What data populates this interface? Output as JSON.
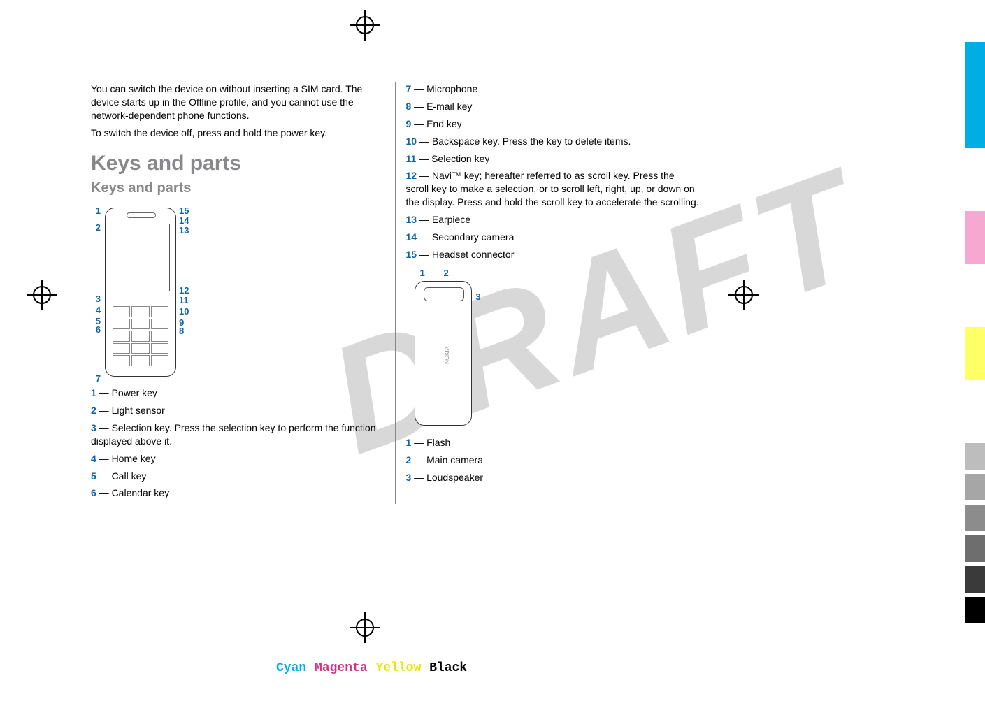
{
  "watermark": "DRAFT",
  "intro": {
    "p1": "You can switch the device on without inserting a SIM card. The device starts up in the Offline profile, and you cannot use the network-dependent phone functions.",
    "p2": "To switch the device off, press and hold the power key."
  },
  "headings": {
    "h1": "Keys and parts",
    "h2": "Keys and parts"
  },
  "diagram1_labels": {
    "l1": "1",
    "l2": "2",
    "l3": "3",
    "l4": "4",
    "l5": "5",
    "l6": "6",
    "l7": "7",
    "r15": "15",
    "r14": "14",
    "r13": "13",
    "r12": "12",
    "r11": "11",
    "r10": "10",
    "r9": "9",
    "r8": "8"
  },
  "front_items": [
    {
      "n": "1",
      "t": " — Power key"
    },
    {
      "n": "2",
      "t": " — Light sensor"
    },
    {
      "n": "3",
      "t": " — Selection key. Press the selection key to perform the function displayed above it."
    },
    {
      "n": "4",
      "t": " — Home key"
    },
    {
      "n": "5",
      "t": " — Call key"
    },
    {
      "n": "6",
      "t": " — Calendar key"
    },
    {
      "n": "7",
      "t": " — Microphone"
    },
    {
      "n": "8",
      "t": " — E-mail key"
    },
    {
      "n": "9",
      "t": " — End key"
    },
    {
      "n": "10",
      "t": " — Backspace key. Press the key to delete items."
    },
    {
      "n": "11",
      "t": " — Selection key"
    },
    {
      "n": "12",
      "t": " — Navi™ key; hereafter referred to as scroll key. Press the scroll key to make a selection, or to scroll left, right, up, or down on the display. Press and hold the scroll key to accelerate the scrolling."
    },
    {
      "n": "13",
      "t": " — Earpiece"
    },
    {
      "n": "14",
      "t": " — Secondary camera"
    },
    {
      "n": "15",
      "t": " — Headset connector"
    }
  ],
  "diagram2_labels": {
    "l1": "1",
    "l2": "2",
    "l3": "3"
  },
  "back_items": [
    {
      "n": "1",
      "t": " — Flash"
    },
    {
      "n": "2",
      "t": " — Main camera"
    },
    {
      "n": "3",
      "t": " — Loudspeaker"
    }
  ],
  "phone_back_brand": "NOKIA",
  "footer": {
    "cyan": "Cyan",
    "magenta": "Magenta",
    "yellow": "Yellow",
    "black": "Black"
  },
  "colorbar_colors": [
    "#00aee6",
    "#00aee6",
    "#00aee6",
    "#00aee6",
    "",
    "#f7a8d0",
    "#f7a8d0",
    "",
    "#ffff66",
    "#ffff66",
    "",
    "#bdbdbd",
    "#a6a6a6",
    "#8c8c8c",
    "#6e6e6e",
    "#3a3a3a",
    "#000000"
  ]
}
